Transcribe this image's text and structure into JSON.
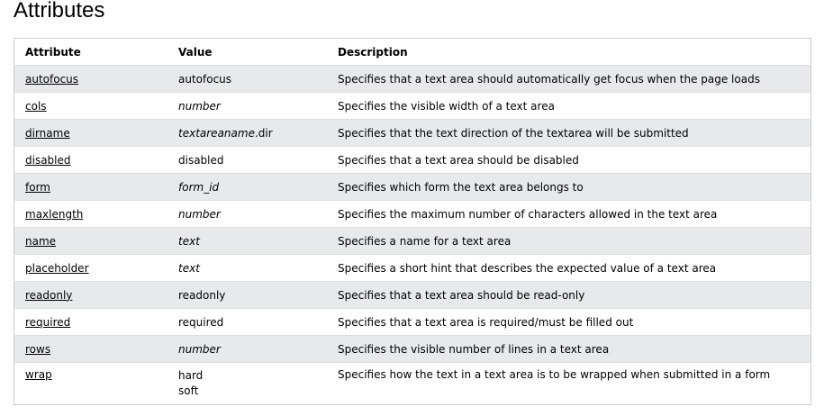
{
  "heading": "Attributes",
  "table": {
    "headers": [
      "Attribute",
      "Value",
      "Description"
    ],
    "rows": [
      {
        "attribute": "autofocus",
        "value": "autofocus",
        "value_italic": false,
        "description": "Specifies that a text area should automatically get focus when the page loads"
      },
      {
        "attribute": "cols",
        "value": "number",
        "value_italic": true,
        "description": "Specifies the visible width of a text area"
      },
      {
        "attribute": "dirname",
        "value_parts": [
          {
            "text": "textareaname",
            "italic": true
          },
          {
            "text": ".dir",
            "italic": false
          }
        ],
        "description": "Specifies that the text direction of the textarea will be submitted"
      },
      {
        "attribute": "disabled",
        "value": "disabled",
        "value_italic": false,
        "description": "Specifies that a text area should be disabled"
      },
      {
        "attribute": "form",
        "value": "form_id",
        "value_italic": true,
        "description": "Specifies which form the text area belongs to"
      },
      {
        "attribute": "maxlength",
        "value": "number",
        "value_italic": true,
        "description": "Specifies the maximum number of characters allowed in the text area"
      },
      {
        "attribute": "name",
        "value": "text",
        "value_italic": true,
        "description": "Specifies a name for a text area"
      },
      {
        "attribute": "placeholder",
        "value": "text",
        "value_italic": true,
        "description": "Specifies a short hint that describes the expected value of a text area"
      },
      {
        "attribute": "readonly",
        "value": "readonly",
        "value_italic": false,
        "description": "Specifies that a text area should be read-only"
      },
      {
        "attribute": "required",
        "value": "required",
        "value_italic": false,
        "description": "Specifies that a text area is required/must be filled out"
      },
      {
        "attribute": "rows",
        "value": "number",
        "value_italic": true,
        "description": "Specifies the visible number of lines in a text area"
      },
      {
        "attribute": "wrap",
        "value_lines": [
          "hard",
          "soft"
        ],
        "description": "Specifies how the text in a text area is to be wrapped when submitted in a form"
      }
    ]
  }
}
